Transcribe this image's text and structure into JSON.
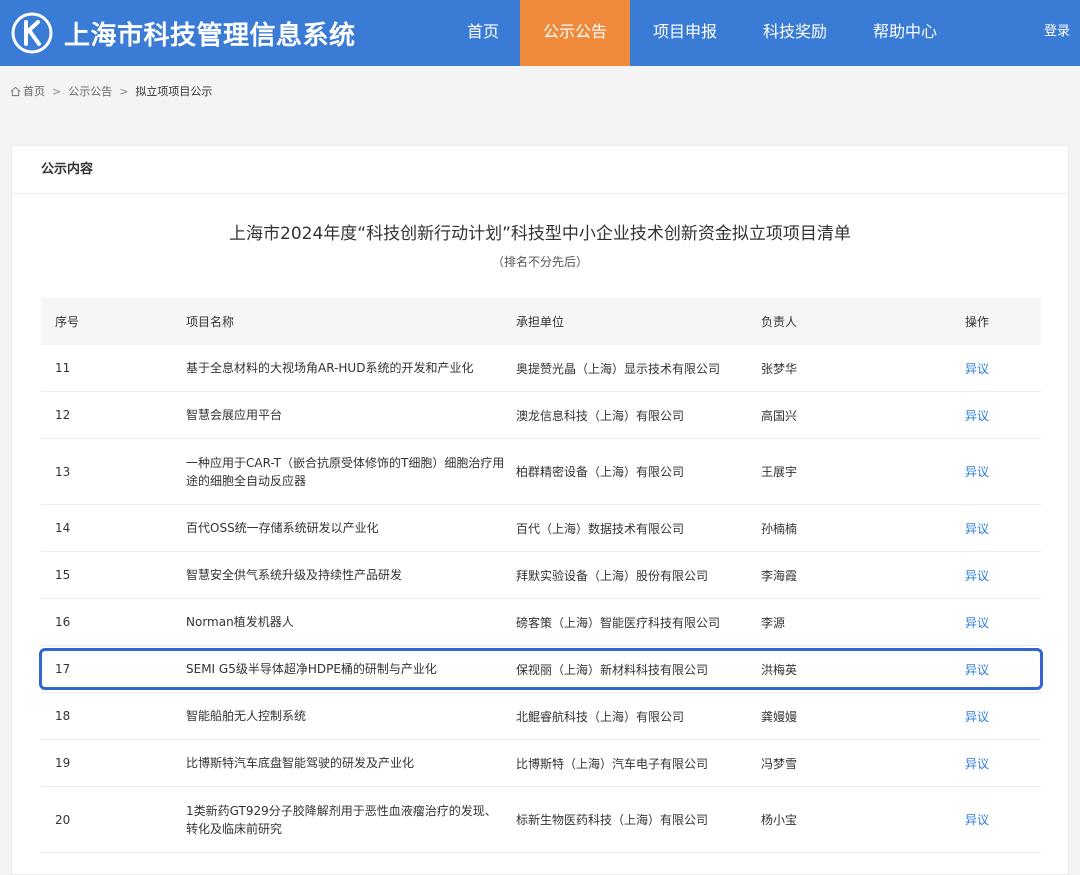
{
  "header": {
    "logo_text": "上海市科技管理信息系统",
    "nav": [
      {
        "label": "首页",
        "active": false
      },
      {
        "label": "公示公告",
        "active": true
      },
      {
        "label": "项目申报",
        "active": false
      },
      {
        "label": "科技奖励",
        "active": false
      },
      {
        "label": "帮助中心",
        "active": false
      }
    ],
    "login_label": "登录",
    "colors": {
      "bar": "#3a7bd5",
      "active_tab": "#ef8a3b"
    }
  },
  "breadcrumb": {
    "items": [
      "首页",
      "公示公告",
      "拟立项项目公示"
    ],
    "separator": ">"
  },
  "card": {
    "heading": "公示内容",
    "title": "上海市2024年度“科技创新行动计划”科技型中小企业技术创新资金拟立项项目清单",
    "subtitle": "（排名不分先后）"
  },
  "table": {
    "columns": [
      "序号",
      "项目名称",
      "承担单位",
      "负责人",
      "操作"
    ],
    "action_label": "异议",
    "highlight_row": "17",
    "rows": [
      {
        "no": "11",
        "name": "基于全息材料的大视场角AR-HUD系统的开发和产业化",
        "org": "奥提赞光晶（上海）显示技术有限公司",
        "lead": "张梦华"
      },
      {
        "no": "12",
        "name": "智慧会展应用平台",
        "org": "澳龙信息科技（上海）有限公司",
        "lead": "高国兴"
      },
      {
        "no": "13",
        "name": "一种应用于CAR-T（嵌合抗原受体修饰的T细胞）细胞治疗用途的细胞全自动反应器",
        "org": "柏群精密设备（上海）有限公司",
        "lead": "王展宇"
      },
      {
        "no": "14",
        "name": "百代OSS统一存储系统研发以产业化",
        "org": "百代（上海）数据技术有限公司",
        "lead": "孙楠楠"
      },
      {
        "no": "15",
        "name": "智慧安全供气系统升级及持续性产品研发",
        "org": "拜默实验设备（上海）股份有限公司",
        "lead": "李海霞"
      },
      {
        "no": "16",
        "name": "Norman植发机器人",
        "org": "磅客策（上海）智能医疗科技有限公司",
        "lead": "李源"
      },
      {
        "no": "17",
        "name": "SEMI G5级半导体超净HDPE桶的研制与产业化",
        "org": "保视丽（上海）新材料科技有限公司",
        "lead": "洪梅英"
      },
      {
        "no": "18",
        "name": "智能船舶无人控制系统",
        "org": "北鲲睿航科技（上海）有限公司",
        "lead": "龚嫚嫚"
      },
      {
        "no": "19",
        "name": "比博斯特汽车底盘智能驾驶的研发及产业化",
        "org": "比博斯特（上海）汽车电子有限公司",
        "lead": "冯梦雪"
      },
      {
        "no": "20",
        "name": "1类新药GT929分子胶降解剂用于恶性血液瘤治疗的发现、转化及临床前研究",
        "org": "标新生物医药科技（上海）有限公司",
        "lead": "杨小宝"
      }
    ]
  }
}
